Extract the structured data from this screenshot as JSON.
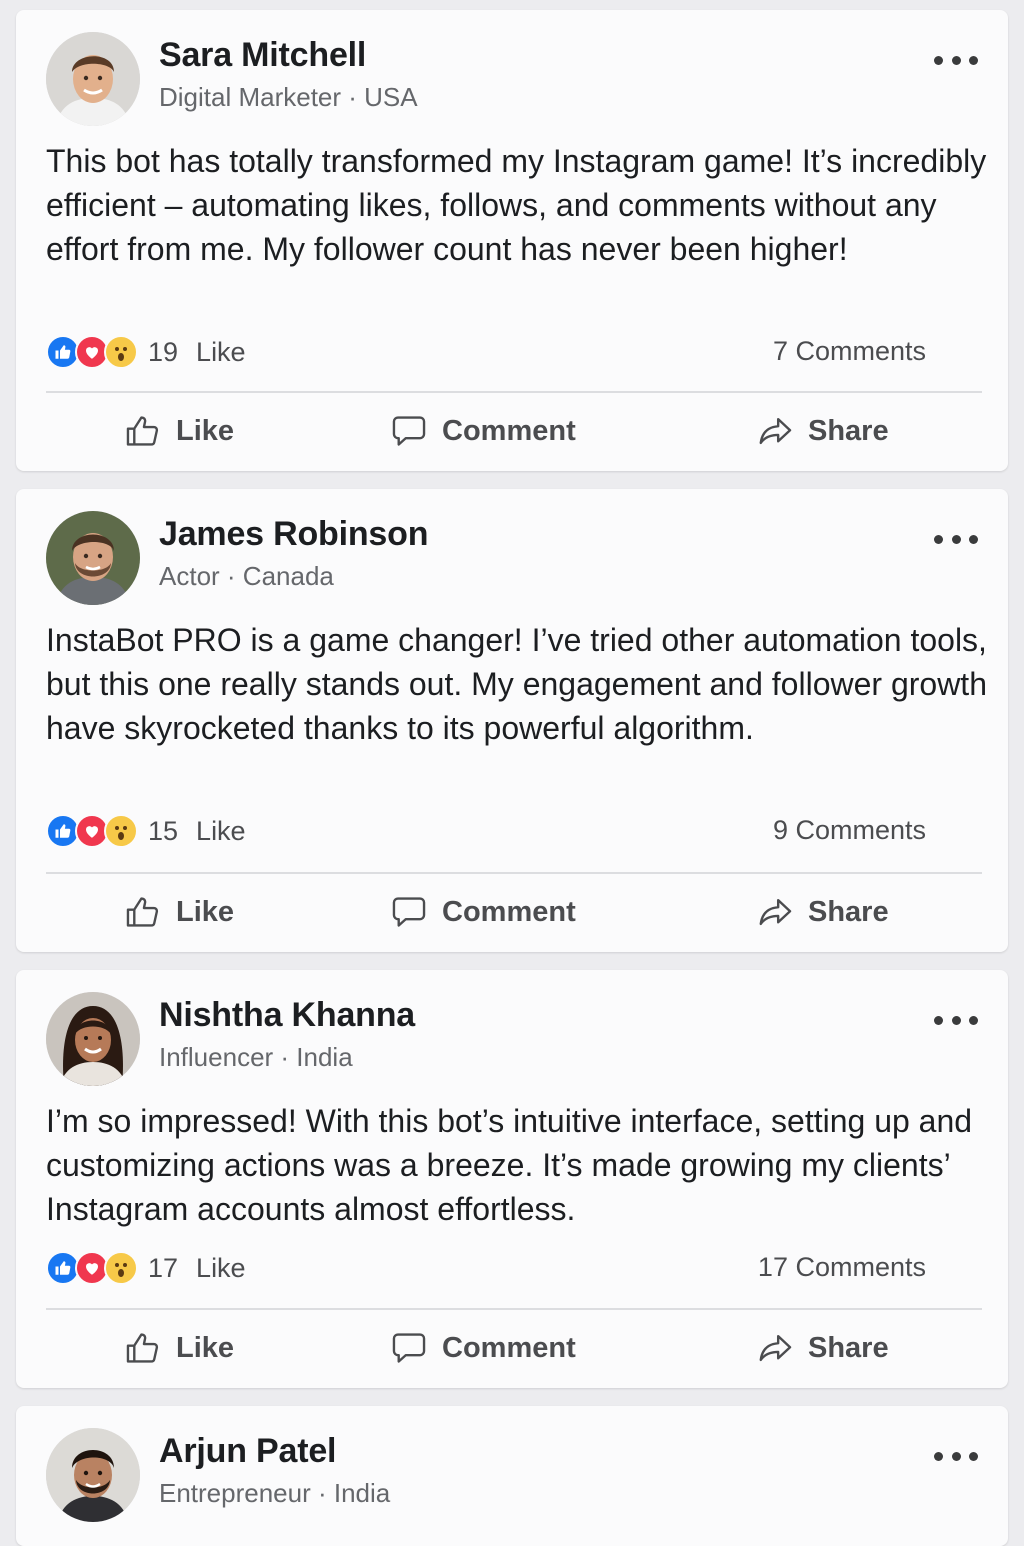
{
  "actions": {
    "like": "Like",
    "comment": "Comment",
    "share": "Share"
  },
  "posts": [
    {
      "name": "Sara Mitchell",
      "subtitle": "Digital Marketer · USA",
      "text": "This bot has totally transformed my Instagram game! It’s incredibly efficient – automating likes, follows, and comments without any effort from me. My follower count has never been higher!",
      "reaction_count": "19",
      "reaction_label": "Like",
      "comments": "7 Comments"
    },
    {
      "name": "James Robinson",
      "subtitle": "Actor · Canada",
      "text": "InstaBot PRO is a game changer! I’ve tried other automation tools, but this one really stands out. My engagement and follower growth have skyrocketed thanks to its powerful algorithm.",
      "reaction_count": "15",
      "reaction_label": "Like",
      "comments": "9 Comments"
    },
    {
      "name": "Nishtha Khanna",
      "subtitle": "Influencer · India",
      "text": "I’m so impressed! With this bot’s intuitive interface, setting up and customizing actions was a breeze. It’s made growing my clients’ Instagram accounts almost effortless.",
      "reaction_count": "17",
      "reaction_label": "Like",
      "comments": "17 Comments"
    },
    {
      "name": "Arjun Patel",
      "subtitle": "Entrepreneur · India"
    }
  ],
  "icons": {
    "reactions": [
      "like-reaction-icon",
      "love-reaction-icon",
      "wow-reaction-icon"
    ],
    "actions": [
      "thumbs-up-icon",
      "comment-bubble-icon",
      "share-arrow-icon"
    ],
    "menu": "more-options-icon"
  },
  "colors": {
    "background": "#ececef",
    "card": "#fbfbfc",
    "like_blue": "#1877f2",
    "love_red": "#f0374e",
    "wow_yellow": "#f7c948",
    "muted_text": "#65676b"
  }
}
